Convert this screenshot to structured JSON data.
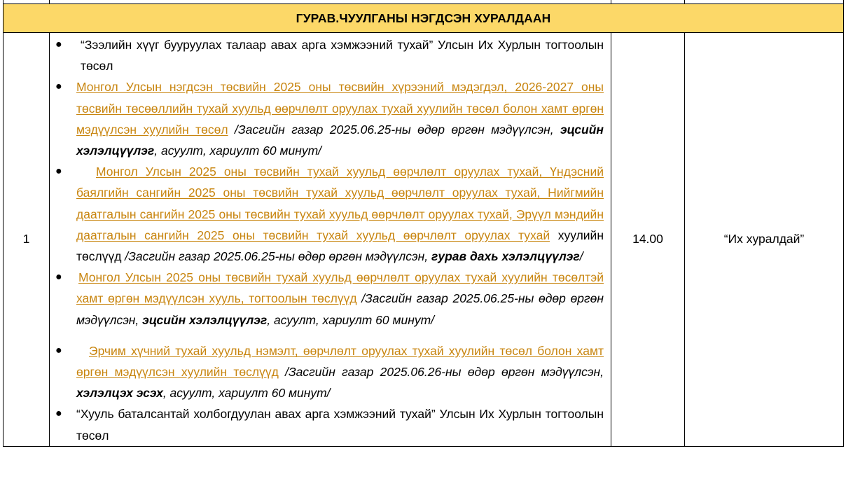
{
  "session_title": "ГУРАВ.ЧУУЛГАНЫ НЭГДСЭН ХУРАЛДААН",
  "row": {
    "number": "1",
    "time": "14.00",
    "location": "“Их хуралдай”"
  },
  "colors": {
    "header_bg": "#fcd868",
    "link": "#c8850f"
  },
  "items": [
    {
      "plain": "“Зээлийн хүүг бууруулах талаар авах арга хэмжээний тухай” Улсын Их Хурлын тогтоолын төсөл"
    },
    {
      "link": "Монгол Улсын нэгдсэн төсвийн 2025 оны төсвийн хүрээний мэдэгдэл, 2026-2027 оны төсвийн төсөөллийн тухай хуульд өөрчлөлт оруулах тухай хуулийн төсөл болон хамт өргөн мэдүүлсэн хуулийн төсөл",
      "note_a": " /Засгийн газар 2025.06.25-ны өдөр өргөн мэдүүлсэн, ",
      "note_bold": "эцсийн хэлэлцүүлэг",
      "note_b": ", асуулт, хариулт 60 минут/"
    },
    {
      "link": "Монгол Улсын 2025 оны төсвийн тухай хуульд  өөрчлөлт оруулах тухай, Үндэсний баялгийн сангийн 2025 оны төсвийн тухай хуульд өөрчлөлт оруулах тухай, Нийгмийн даатгалын сангийн 2025 оны төсвийн тухай хуульд өөрчлөлт оруулах тухай, Эрүүл мэндийн даатгалын сангийн 2025 оны төсвийн тухай хуульд өөрчлөлт оруулах тухай",
      "after": " хуулийн төслүүд  ",
      "note_a": "/Засгийн газар 2025.06.25-ны өдөр өргөн мэдүүлсэн, ",
      "note_bold": "гурав дахь хэлэлцүүлэг",
      "note_b": "/"
    },
    {
      "link": "Монгол Улсын 2025 оны төсвийн тухай хуульд өөрчлөлт оруулах тухай хуулийн төсөлтэй хамт өргөн мэдүүлсэн хууль, тогтоолын төслүүд",
      "note_a": " /Засгийн газар 2025.06.25-ны өдөр өргөн мэдүүлсэн, ",
      "note_bold": "эцсийн хэлэлцүүлэг",
      "note_b": ", асуулт, хариулт 60 минут/"
    },
    {
      "link": "Эрчим хүчний тухай хуульд нэмэлт, өөрчлөлт оруулах тухай хуулийн төсөл болон хамт өргөн мэдүүлсэн хуулийн төслүүд",
      "note_a": " /Засгийн газар 2025.06.26-ны өдөр өргөн мэдүүлсэн, ",
      "note_bold": "хэлэлцэх эсэх",
      "note_b": ", асуулт, хариулт 60 минут/"
    },
    {
      "plain": "“Хууль баталсантай холбогдуулан авах арга хэмжээний тухай” Улсын Их Хурлын тогтоолын төсөл"
    }
  ]
}
